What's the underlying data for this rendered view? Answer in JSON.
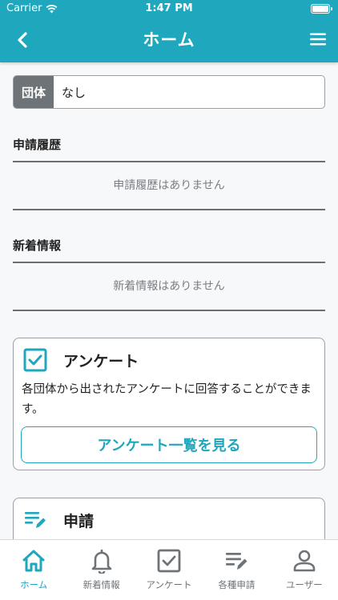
{
  "status_bar": {
    "carrier": "Carrier",
    "time": "1:47 PM"
  },
  "nav": {
    "title": "ホーム"
  },
  "group_field": {
    "tag": "団体",
    "value": "なし"
  },
  "history": {
    "title": "申請履歴",
    "empty": "申請履歴はありません"
  },
  "news": {
    "title": "新着情報",
    "empty": "新着情報はありません"
  },
  "survey_card": {
    "title": "アンケート",
    "description": "各団体から出されたアンケートに回答することができます。",
    "button": "アンケート一覧を見る"
  },
  "application_card": {
    "title": "申請"
  },
  "tabs": [
    {
      "label": "ホーム",
      "icon": "home-icon",
      "active": true
    },
    {
      "label": "新着情報",
      "icon": "bell-icon",
      "active": false
    },
    {
      "label": "アンケート",
      "icon": "checkbox-icon",
      "active": false
    },
    {
      "label": "各種申請",
      "icon": "edit-list-icon",
      "active": false
    },
    {
      "label": "ユーザー",
      "icon": "user-icon",
      "active": false
    }
  ],
  "colors": {
    "accent": "#1fa7bd",
    "tag_bg": "#6e7377",
    "muted_text": "#7a7e82"
  }
}
